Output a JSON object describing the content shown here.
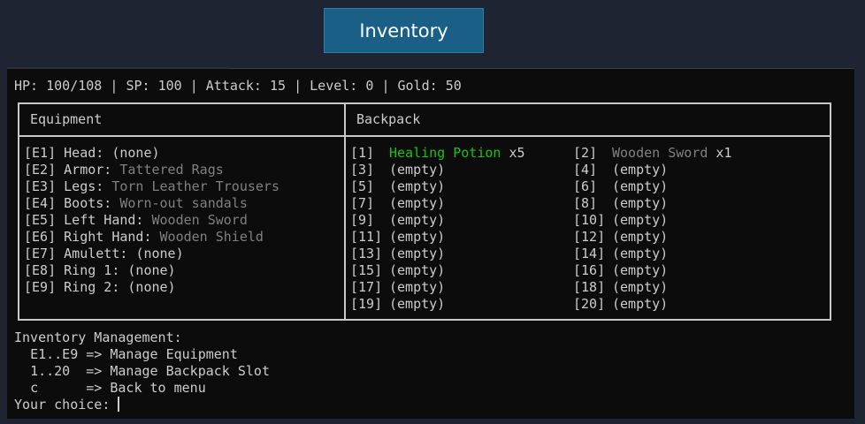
{
  "window": {
    "title": "Inventory"
  },
  "status_bar": {
    "hp_label": "HP:",
    "hp": "100/108",
    "sp_label": "SP:",
    "sp": "100",
    "attack_label": "Attack:",
    "attack": "15",
    "level_label": "Level:",
    "level": "0",
    "gold_label": "Gold:",
    "gold": "50",
    "separator": "|"
  },
  "equipment": {
    "header": "Equipment",
    "slots": [
      {
        "code": "[E1]",
        "label": "Head:",
        "value": "(none)",
        "empty": true
      },
      {
        "code": "[E2]",
        "label": "Armor:",
        "value": "Tattered Rags",
        "empty": false
      },
      {
        "code": "[E3]",
        "label": "Legs:",
        "value": "Torn Leather Trousers",
        "empty": false
      },
      {
        "code": "[E4]",
        "label": "Boots:",
        "value": "Worn-out sandals",
        "empty": false
      },
      {
        "code": "[E5]",
        "label": "Left Hand:",
        "value": "Wooden Sword",
        "empty": false
      },
      {
        "code": "[E6]",
        "label": "Right Hand:",
        "value": "Wooden Shield",
        "empty": false
      },
      {
        "code": "[E7]",
        "label": "Amulett:",
        "value": "(none)",
        "empty": true
      },
      {
        "code": "[E8]",
        "label": "Ring 1:",
        "value": "(none)",
        "empty": true
      },
      {
        "code": "[E9]",
        "label": "Ring 2:",
        "value": "(none)",
        "empty": true
      }
    ]
  },
  "backpack": {
    "header": "Backpack",
    "slots": [
      {
        "code": "[1]",
        "item": "Healing Potion",
        "qty": "x5",
        "color": "#16c60c"
      },
      {
        "code": "[2]",
        "item": "Wooden Sword",
        "qty": "x1",
        "color": "#808080"
      },
      {
        "code": "[3]",
        "item": "(empty)",
        "qty": ""
      },
      {
        "code": "[4]",
        "item": "(empty)",
        "qty": ""
      },
      {
        "code": "[5]",
        "item": "(empty)",
        "qty": ""
      },
      {
        "code": "[6]",
        "item": "(empty)",
        "qty": ""
      },
      {
        "code": "[7]",
        "item": "(empty)",
        "qty": ""
      },
      {
        "code": "[8]",
        "item": "(empty)",
        "qty": ""
      },
      {
        "code": "[9]",
        "item": "(empty)",
        "qty": ""
      },
      {
        "code": "[10]",
        "item": "(empty)",
        "qty": ""
      },
      {
        "code": "[11]",
        "item": "(empty)",
        "qty": ""
      },
      {
        "code": "[12]",
        "item": "(empty)",
        "qty": ""
      },
      {
        "code": "[13]",
        "item": "(empty)",
        "qty": ""
      },
      {
        "code": "[14]",
        "item": "(empty)",
        "qty": ""
      },
      {
        "code": "[15]",
        "item": "(empty)",
        "qty": ""
      },
      {
        "code": "[16]",
        "item": "(empty)",
        "qty": ""
      },
      {
        "code": "[17]",
        "item": "(empty)",
        "qty": ""
      },
      {
        "code": "[18]",
        "item": "(empty)",
        "qty": ""
      },
      {
        "code": "[19]",
        "item": "(empty)",
        "qty": ""
      },
      {
        "code": "[20]",
        "item": "(empty)",
        "qty": ""
      }
    ]
  },
  "menu": {
    "title": "Inventory Management:",
    "options": [
      {
        "key": "E1..E9",
        "arrow": "=>",
        "action": "Manage Equipment"
      },
      {
        "key": "1..20",
        "arrow": "=>",
        "action": "Manage Backpack Slot"
      },
      {
        "key": "c",
        "arrow": "=>",
        "action": "Back to menu"
      }
    ],
    "prompt": "Your choice:",
    "input": ""
  },
  "colors": {
    "background": "#1f2433",
    "title_tab": "#1a5f86",
    "terminal_bg": "#0c0c0c",
    "text": "#cccccc",
    "dim_text": "#808080",
    "highlight_green": "#16c60c"
  }
}
